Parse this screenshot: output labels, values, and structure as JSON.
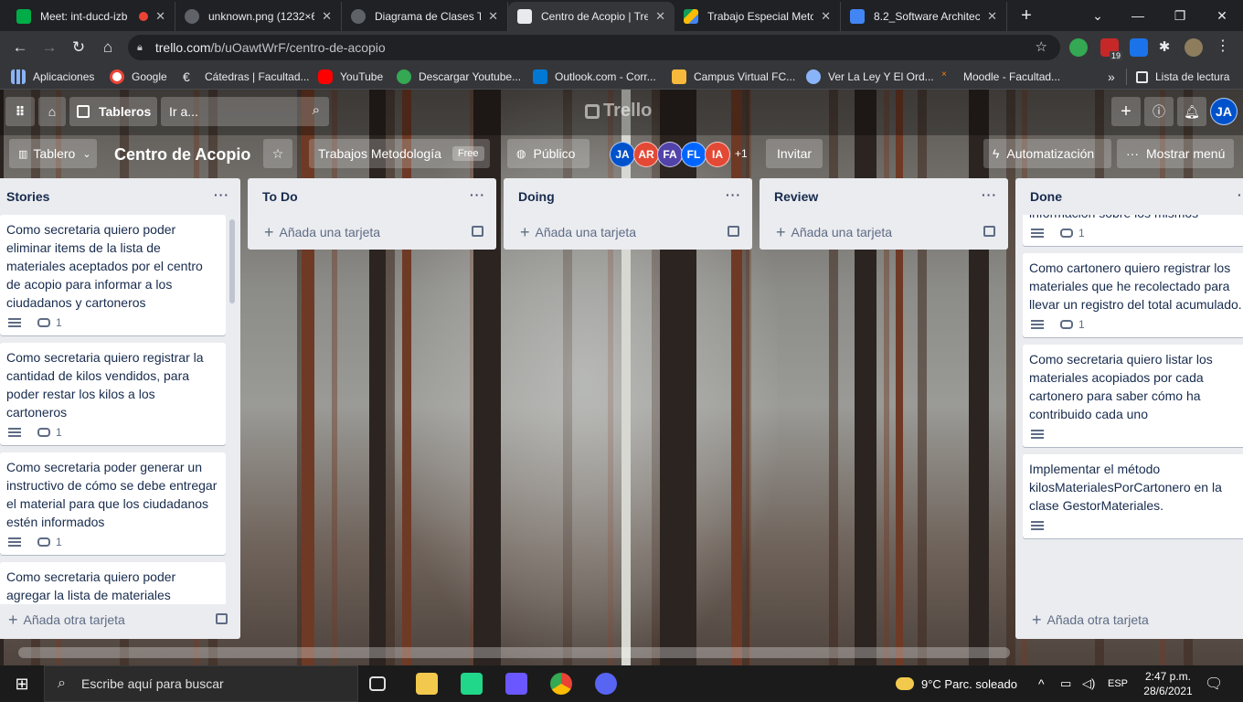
{
  "browser": {
    "tabs": [
      {
        "title": "Meet: int-ducd-izb",
        "color": "#00ac47"
      },
      {
        "title": "unknown.png (1232×6",
        "color": "#5f6368"
      },
      {
        "title": "Diagrama de Clases TI",
        "color": "#5f6368"
      },
      {
        "title": "Centro de Acopio | Tre",
        "color": "#0079bf"
      },
      {
        "title": "Trabajo Especial Meto",
        "color": "#fbbc04"
      },
      {
        "title": "8.2_Software Architect",
        "color": "#4285f4"
      }
    ],
    "new_tab": "+",
    "url_host": "trello.com",
    "url_path": "/b/uOawtWrF/centro-de-acopio",
    "bookmarks": [
      {
        "label": "Aplicaciones",
        "color": "#8ab4f8"
      },
      {
        "label": "Google",
        "color": "#ea4335"
      },
      {
        "label": "Cátedras | Facultad...",
        "color": "#e8eaed"
      },
      {
        "label": "YouTube",
        "color": "#ff0000"
      },
      {
        "label": "Descargar Youtube...",
        "color": "#34a853"
      },
      {
        "label": "Outlook.com - Corr...",
        "color": "#0078d4"
      },
      {
        "label": "Campus Virtual FC...",
        "color": "#f6b93b"
      },
      {
        "label": "Ver La Ley Y El Ord...",
        "color": "#8ab4f8"
      },
      {
        "label": "Moodle - Facultad...",
        "color": "#f98012"
      }
    ],
    "overflow": "»",
    "reading_list": "Lista de lectura",
    "ext_badge": "19"
  },
  "trello": {
    "logo": "Trello",
    "boards_label": "Tableros",
    "search_placeholder": "Ir a...",
    "user_initials": "JA",
    "board_menu": "Tablero",
    "board_title": "Centro de Acopio",
    "workspace": "Trabajos Metodología",
    "plan": "Free",
    "visibility": "Público",
    "members": [
      {
        "initials": "JA",
        "color": "#0052cc"
      },
      {
        "initials": "AR",
        "color": "#e34935"
      },
      {
        "initials": "FA",
        "color": "#5243aa"
      },
      {
        "initials": "FL",
        "color": "#0065ff"
      },
      {
        "initials": "IA",
        "color": "#e34935"
      }
    ],
    "more_members": "+1",
    "invite": "Invitar",
    "automation": "Automatización",
    "show_menu": "Mostrar menú",
    "add_card": "Añada una tarjeta",
    "add_another_card": "Añada otra tarjeta",
    "lists": [
      {
        "name": "Stories",
        "cards": [
          {
            "text": "Como secretaria quiero poder eliminar items de la lista de materiales aceptados por el centro de acopio para informar a los ciudadanos y cartoneros",
            "comments": "1"
          },
          {
            "text": "Como secretaria quiero registrar la cantidad de kilos vendidos, para poder restar los kilos a los cartoneros",
            "comments": "1"
          },
          {
            "text": "Como secretaria poder generar un instructivo de cómo se debe entregar el material para que los ciudadanos estén informados",
            "comments": "1"
          },
          {
            "text": "Como secretaria quiero poder agregar la lista de materiales",
            "comments": ""
          }
        ]
      },
      {
        "name": "To Do",
        "cards": []
      },
      {
        "name": "Doing",
        "cards": []
      },
      {
        "name": "Review",
        "cards": []
      },
      {
        "name": "Done",
        "cards": [
          {
            "text": "información sobre los mismos",
            "comments": "1"
          },
          {
            "text": "Como cartonero quiero registrar los materiales que he recolectado para llevar un registro del total acumulado.",
            "comments": "1"
          },
          {
            "text": "Como secretaria quiero listar los materiales acopiados por cada cartonero para saber cómo ha contribuido cada uno",
            "comments": ""
          },
          {
            "text": "Implementar el método kilosMaterialesPorCartonero en la clase GestorMateriales.",
            "comments": ""
          }
        ]
      }
    ]
  },
  "taskbar": {
    "search_placeholder": "Escribe aquí para buscar",
    "weather": "9°C  Parc. soleado",
    "lang": "ESP",
    "time": "2:47 p.m.",
    "date": "28/6/2021"
  }
}
